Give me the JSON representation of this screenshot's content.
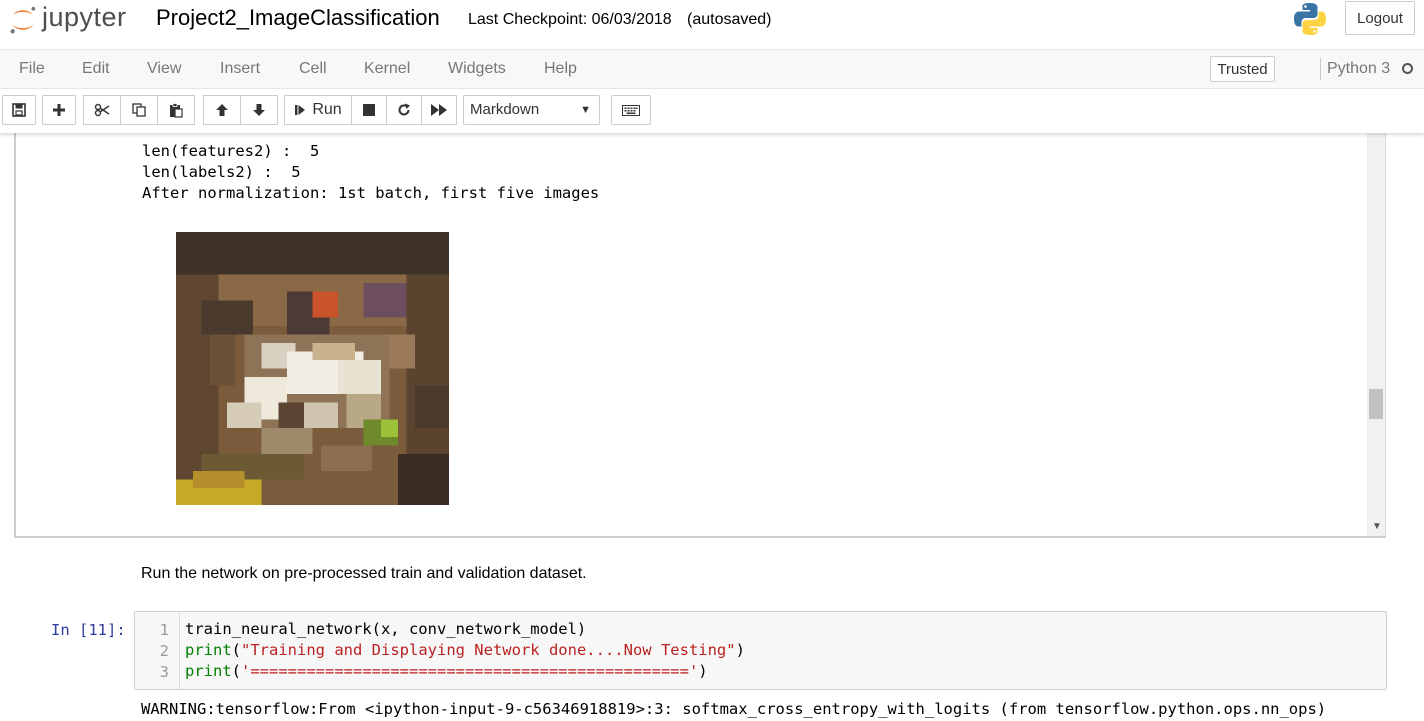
{
  "header": {
    "logo_text": "jupyter",
    "notebook_name": "Project2_ImageClassification",
    "checkpoint": "Last Checkpoint: 06/03/2018",
    "autosave": "(autosaved)",
    "logout_label": "Logout"
  },
  "menubar": {
    "items": [
      "File",
      "Edit",
      "View",
      "Insert",
      "Cell",
      "Kernel",
      "Widgets",
      "Help"
    ],
    "trusted_label": "Trusted",
    "kernel_name": "Python 3"
  },
  "toolbar": {
    "run_label": "Run",
    "cell_type": "Markdown",
    "buttons": [
      "save-icon",
      "plus-icon",
      "scissors-icon",
      "copy-icon",
      "paste-icon",
      "arrow-up-icon",
      "arrow-down-icon",
      "run-icon",
      "stop-icon",
      "restart-icon",
      "fast-forward-icon",
      "keyboard-icon"
    ]
  },
  "output": {
    "lines": [
      "len(features2) :  5",
      "len(labels2) :  5",
      "After normalization: 1st batch, first five images"
    ]
  },
  "markdown_cell": {
    "text": "Run the network on pre-processed train and validation dataset."
  },
  "code_cell": {
    "prompt": "In [11]:",
    "line_numbers": [
      "1",
      "2",
      "3"
    ],
    "line1": "train_neural_network(x, conv_network_model)",
    "line2_fn": "print",
    "line2_open": "(",
    "line2_str": "\"Training and Displaying Network done....Now Testing\"",
    "line2_close": ")",
    "line3_fn": "print",
    "line3_open": "(",
    "line3_str": "'==============================================='",
    "line3_close": ")"
  },
  "warning": {
    "text": "WARNING:tensorflow:From <ipython-input-9-c56346918819>:3: softmax_cross_entropy_with_logits (from tensorflow.python.ops.nn_ops)"
  },
  "colors": {
    "prompt": "#303f9f",
    "string": "#ba2121",
    "builtin": "#008000",
    "logo_orange": "#f37726"
  }
}
